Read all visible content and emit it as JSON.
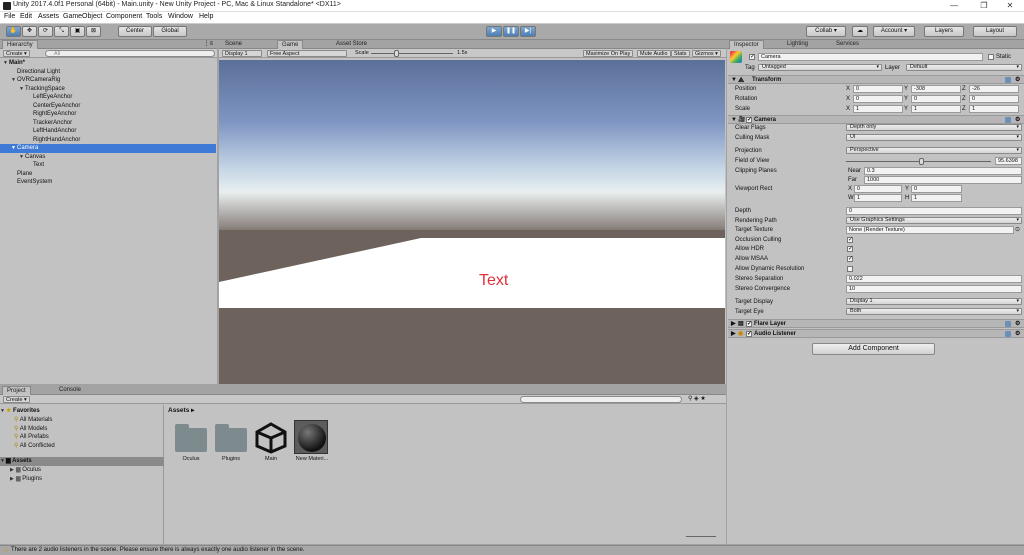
{
  "window": {
    "title": "Unity 2017.4.0f1 Personal (64bit) - Main.unity - New Unity Project - PC, Mac & Linux Standalone* <DX11>"
  },
  "menu": [
    "File",
    "Edit",
    "Assets",
    "GameObject",
    "Component",
    "Tools",
    "Window",
    "Help"
  ],
  "toolbar": {
    "pivot": "Center",
    "space": "Global",
    "collab": "Collab ▾",
    "account": "Account ▾",
    "layers": "Layers",
    "layout": "Layout"
  },
  "hierarchy": {
    "tab": "Hierarchy",
    "create": "Create ▾",
    "search_placeholder": "All",
    "items": [
      {
        "label": "Main*",
        "depth": 0,
        "expanded": true,
        "selected": false,
        "scene": true
      },
      {
        "label": "Directional Light",
        "depth": 1,
        "expanded": null,
        "selected": false
      },
      {
        "label": "OVRCameraRig",
        "depth": 1,
        "expanded": true,
        "selected": false
      },
      {
        "label": "TrackingSpace",
        "depth": 2,
        "expanded": true,
        "selected": false
      },
      {
        "label": "LeftEyeAnchor",
        "depth": 3,
        "expanded": null,
        "selected": false
      },
      {
        "label": "CenterEyeAnchor",
        "depth": 3,
        "expanded": null,
        "selected": false
      },
      {
        "label": "RightEyeAnchor",
        "depth": 3,
        "expanded": null,
        "selected": false
      },
      {
        "label": "TrackerAnchor",
        "depth": 3,
        "expanded": null,
        "selected": false
      },
      {
        "label": "LeftHandAnchor",
        "depth": 3,
        "expanded": null,
        "selected": false
      },
      {
        "label": "RightHandAnchor",
        "depth": 3,
        "expanded": null,
        "selected": false
      },
      {
        "label": "Camera",
        "depth": 1,
        "expanded": true,
        "selected": true
      },
      {
        "label": "Canvas",
        "depth": 2,
        "expanded": true,
        "selected": false
      },
      {
        "label": "Text",
        "depth": 3,
        "expanded": null,
        "selected": false
      },
      {
        "label": "Plane",
        "depth": 1,
        "expanded": null,
        "selected": false
      },
      {
        "label": "EventSystem",
        "depth": 1,
        "expanded": null,
        "selected": false
      }
    ]
  },
  "center": {
    "tabs": [
      "Scene",
      "Game",
      "Asset Store"
    ],
    "display": "Display 1",
    "aspect": "Free Aspect",
    "scale_label": "Scale",
    "scale_value": "1.5x",
    "maximize": "Maximize On Play",
    "mute": "Mute Audio",
    "stats": "Stats",
    "gizmos": "Gizmos ▾",
    "game_text": "Text",
    "text_color": "#e0303a",
    "scale_fraction": 0.3
  },
  "project": {
    "tabs": [
      "Project",
      "Console"
    ],
    "create": "Create ▾",
    "favorites_label": "Favorites",
    "favorites": [
      "All Materials",
      "All Models",
      "All Prefabs",
      "All Conflicted"
    ],
    "assets_label": "Assets",
    "asset_folders": [
      "Oculus",
      "Plugins"
    ],
    "breadcrumb": "Assets ▸",
    "grid": [
      {
        "name": "Oculus",
        "icon": "folder-icon"
      },
      {
        "name": "Plugins",
        "icon": "folder-icon"
      },
      {
        "name": "Main",
        "icon": "unity-scene-icon"
      },
      {
        "name": "New Materi...",
        "icon": "material-sphere-icon"
      }
    ]
  },
  "inspector": {
    "tabs": [
      "Inspector",
      "Lighting",
      "Services"
    ],
    "object_name": "Camera",
    "static_label": "Static",
    "tag_label": "Tag",
    "tag_value": "Untagged",
    "layer_label": "Layer",
    "layer_value": "Default",
    "transform": {
      "title": "Transform",
      "rows": [
        {
          "label": "Position",
          "x": "0",
          "y": "-308",
          "z": "-26"
        },
        {
          "label": "Rotation",
          "x": "0",
          "y": "0",
          "z": "0"
        },
        {
          "label": "Scale",
          "x": "1",
          "y": "1",
          "z": "1"
        }
      ]
    },
    "camera": {
      "title": "Camera",
      "clear_flags_label": "Clear Flags",
      "clear_flags": "Depth only",
      "culling_mask_label": "Culling Mask",
      "culling_mask": "UI",
      "projection_label": "Projection",
      "projection": "Perspective",
      "fov_label": "Field of View",
      "fov": "95.6398",
      "fov_fraction": 0.52,
      "clip_label": "Clipping Planes",
      "near_label": "Near",
      "near": "0.3",
      "far_label": "Far",
      "far": "1000",
      "viewport_label": "Viewport Rect",
      "vx": "0",
      "vy": "0",
      "vw": "1",
      "vh": "1",
      "depth_label": "Depth",
      "depth": "0",
      "rendering_path_label": "Rendering Path",
      "rendering_path": "Use Graphics Settings",
      "target_texture_label": "Target Texture",
      "target_texture": "None (Render Texture)",
      "occlusion_label": "Occlusion Culling",
      "occlusion": true,
      "hdr_label": "Allow HDR",
      "hdr": true,
      "msaa_label": "Allow MSAA",
      "msaa": true,
      "dynres_label": "Allow Dynamic Resolution",
      "dynres": false,
      "stereo_sep_label": "Stereo Separation",
      "stereo_sep": "0.022",
      "stereo_conv_label": "Stereo Convergence",
      "stereo_conv": "10",
      "target_display_label": "Target Display",
      "target_display": "Display 1",
      "target_eye_label": "Target Eye",
      "target_eye": "Both"
    },
    "flare_layer": "Flare Layer",
    "audio_listener": "Audio Listener",
    "add_component": "Add Component"
  },
  "status": {
    "message": "There are 2 audio listeners in the scene. Please ensure there is always exactly one audio listener in the scene."
  }
}
